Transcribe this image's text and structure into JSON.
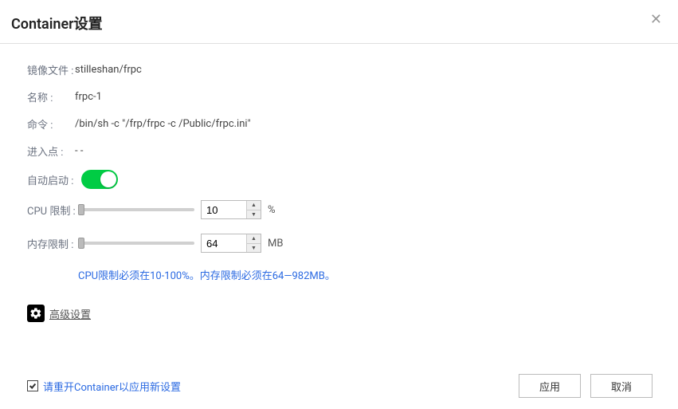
{
  "title": "Container设置",
  "fields": {
    "image_label": "镜像文件 :",
    "image_value": "stilleshan/frpc",
    "name_label": "名称 :",
    "name_value": "frpc-1",
    "command_label": "命令 :",
    "command_value": "/bin/sh -c \"/frp/frpc -c /Public/frpc.ini\"",
    "entrypoint_label": "进入点 :",
    "entrypoint_value": "- -",
    "autostart_label": "自动启动 :",
    "cpu_label": "CPU 限制 :",
    "cpu_value": "10",
    "cpu_unit": "%",
    "memory_label": "内存限制 :",
    "memory_value": "64",
    "memory_unit": "MB"
  },
  "help_text": "CPU限制必须在10-100%。内存限制必须在64—982MB。",
  "advanced_label": "高级设置",
  "restart_label": "请重开Container以应用新设置",
  "buttons": {
    "apply": "应用",
    "cancel": "取消"
  }
}
